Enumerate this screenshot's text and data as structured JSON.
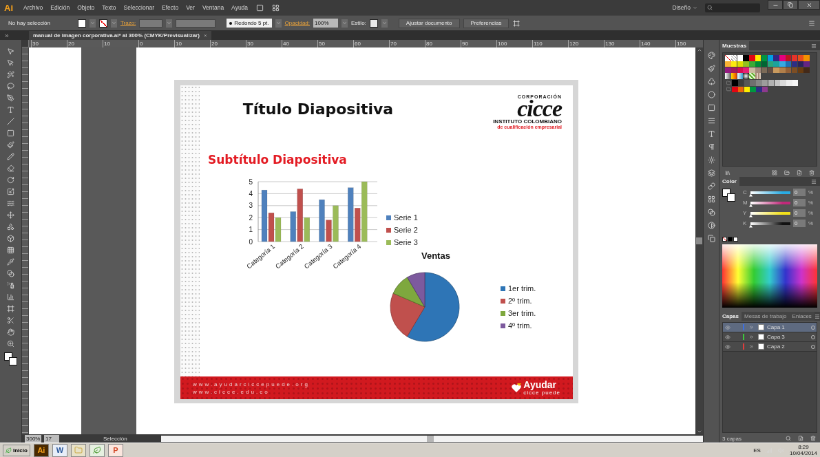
{
  "app": {
    "logo": "Ai",
    "menu": [
      "Archivo",
      "Edición",
      "Objeto",
      "Texto",
      "Seleccionar",
      "Efecto",
      "Ver",
      "Ventana",
      "Ayuda"
    ],
    "workspace": "Diseño"
  },
  "options_bar": {
    "selection_status": "No hay selección",
    "stroke_label": "Trazo:",
    "brush": "Redondo 5 pt.",
    "opacity_label": "Opacidad:",
    "opacity": "100%",
    "style_label": "Estilo:",
    "buttons": [
      "Ajustar documento",
      "Preferencias"
    ]
  },
  "document_tab": {
    "title": "manual de imagen corporativa.ai* al 300% (CMYK/Previsualizar)",
    "close": "×"
  },
  "ruler": [
    "30",
    "20",
    "10",
    "0",
    "10",
    "20",
    "30",
    "40",
    "50",
    "60",
    "70",
    "80",
    "90",
    "100",
    "110",
    "120",
    "130",
    "140",
    "150"
  ],
  "slide": {
    "title": "Título Diapositiva",
    "subtitle": "Subtítulo Diapositiva",
    "logo": {
      "top": "CORPORACIÓN",
      "name": "cicce",
      "line1": "INSTITUTO COLOMBIANO",
      "line2": "de cualificación empresarial"
    },
    "bar_chart": {
      "chart_data": {
        "type": "bar",
        "categories": [
          "Categoría 1",
          "Categoría 2",
          "Categoría 3",
          "Categoría 4"
        ],
        "ylim": [
          0,
          5
        ],
        "yticks": [
          0,
          1,
          2,
          3,
          4,
          5
        ],
        "grid": true,
        "series": [
          {
            "name": "Serie 1",
            "color": "#4f81bd",
            "values": [
              4.3,
              2.5,
              3.5,
              4.5
            ]
          },
          {
            "name": "Serie 2",
            "color": "#c0504d",
            "values": [
              2.4,
              4.4,
              1.8,
              2.8
            ]
          },
          {
            "name": "Serie 3",
            "color": "#9bbb59",
            "values": [
              2,
              2,
              3,
              5
            ]
          }
        ]
      }
    },
    "pie_chart": {
      "chart_data": {
        "type": "pie",
        "title": "Ventas",
        "categories": [
          "1er trim.",
          "2º trim.",
          "3er trim.",
          "4º trim."
        ],
        "values": [
          58.6,
          22.9,
          10,
          8.5
        ]
      }
    },
    "footer": {
      "links": [
        "www.ayudarciccepuede.org",
        "www.cicce.edu.co"
      ],
      "brand": "Ayudar",
      "brand_sub": "cicce puede"
    }
  },
  "status_bar": {
    "zoom": "300%",
    "page": "17",
    "tool": "Selección"
  },
  "swatches_panel": {
    "title": "Muestras",
    "rows": [
      [
        {
          "color": "#000000"
        },
        {
          "color": "#e30613"
        },
        {
          "color": "#ffed00"
        },
        {
          "color": "#009640"
        },
        {
          "color": "#009fe3"
        },
        {
          "color": "#312783"
        },
        {
          "color": "#e6007e"
        },
        {
          "color": "#be1622"
        },
        {
          "color": "#e6332a"
        },
        {
          "color": "#e94e1b"
        },
        {
          "color": "#f39200"
        }
      ],
      [
        {
          "color": "#f9b233"
        },
        {
          "color": "#fcea10"
        },
        {
          "color": "#dedc00"
        },
        {
          "color": "#95c11f"
        },
        {
          "color": "#3aaa35"
        },
        {
          "color": "#008d36"
        },
        {
          "color": "#006633"
        },
        {
          "color": "#2ba67b"
        },
        {
          "color": "#1ba39c"
        },
        {
          "color": "#36a9e1"
        },
        {
          "color": "#1d71b8"
        },
        {
          "color": "#2d2e83"
        },
        {
          "color": "#29235c"
        },
        {
          "color": "#662483"
        }
      ],
      [
        {
          "color": "#951b81"
        },
        {
          "color": "#a3195b"
        },
        {
          "color": "#d60b52"
        },
        {
          "color": "#e71d73"
        },
        {
          "color": "#cbbba0"
        },
        {
          "color": "#a48a7b"
        },
        {
          "color": "#7b6a58"
        },
        {
          "color": "#634e42"
        },
        {
          "color": "#c99a5e"
        },
        {
          "color": "#b17f4a"
        },
        {
          "color": "#936037"
        },
        {
          "color": "#7d4e24"
        },
        {
          "color": "#683c11"
        },
        {
          "color": "#432918"
        }
      ]
    ],
    "gray_group": [
      {
        "color": "#000000"
      },
      {
        "color": "#3c3c3b"
      },
      {
        "color": "#575756"
      },
      {
        "color": "#706f6f"
      },
      {
        "color": "#878787"
      },
      {
        "color": "#9d9d9c"
      },
      {
        "color": "#b2b2b2"
      },
      {
        "color": "#c6c6c6"
      },
      {
        "color": "#dadada"
      },
      {
        "color": "#ededed"
      },
      {
        "color": "#f6f6f6"
      }
    ],
    "bright_group": [
      {
        "color": "#e30613"
      },
      {
        "color": "#ec6608"
      },
      {
        "color": "#ffed00"
      },
      {
        "color": "#009640"
      },
      {
        "color": "#2d2e83"
      },
      {
        "color": "#8e3a8e"
      }
    ]
  },
  "color_panel": {
    "title": "Color",
    "channels": [
      {
        "name": "C",
        "value": "0",
        "unit": "%",
        "level": 0,
        "color": "#29abe2"
      },
      {
        "name": "M",
        "value": "0",
        "unit": "%",
        "level": 0,
        "color": "#c1297a"
      },
      {
        "name": "Y",
        "value": "0",
        "unit": "%",
        "level": 0,
        "color": "#f2e01a"
      },
      {
        "name": "K",
        "value": "0",
        "unit": "%",
        "level": 0,
        "color": "#111111"
      }
    ]
  },
  "layers_panel": {
    "tabs": [
      {
        "label": "Capas",
        "selected": true
      },
      {
        "label": "Mesas de trabajo",
        "selected": false
      },
      {
        "label": "Enlaces",
        "selected": false
      }
    ],
    "layers": [
      {
        "name": "Capa 1",
        "color": "#3d6fe0",
        "selected": true
      },
      {
        "name": "Capa 3",
        "color": "#3cc83c",
        "selected": false
      },
      {
        "name": "Capa 2",
        "color": "#e03c3c",
        "selected": false
      }
    ],
    "count": "3 capas"
  },
  "taskbar": {
    "start": "Inicio",
    "apps": [
      {
        "kind": "illustrator",
        "label": "Ai"
      },
      {
        "kind": "word",
        "label": "W"
      },
      {
        "kind": "folder"
      },
      {
        "kind": "leaf"
      },
      {
        "kind": "powerpoint",
        "label": "P"
      }
    ],
    "language": "ES",
    "time": "8:29",
    "date": "10/04/2014"
  }
}
